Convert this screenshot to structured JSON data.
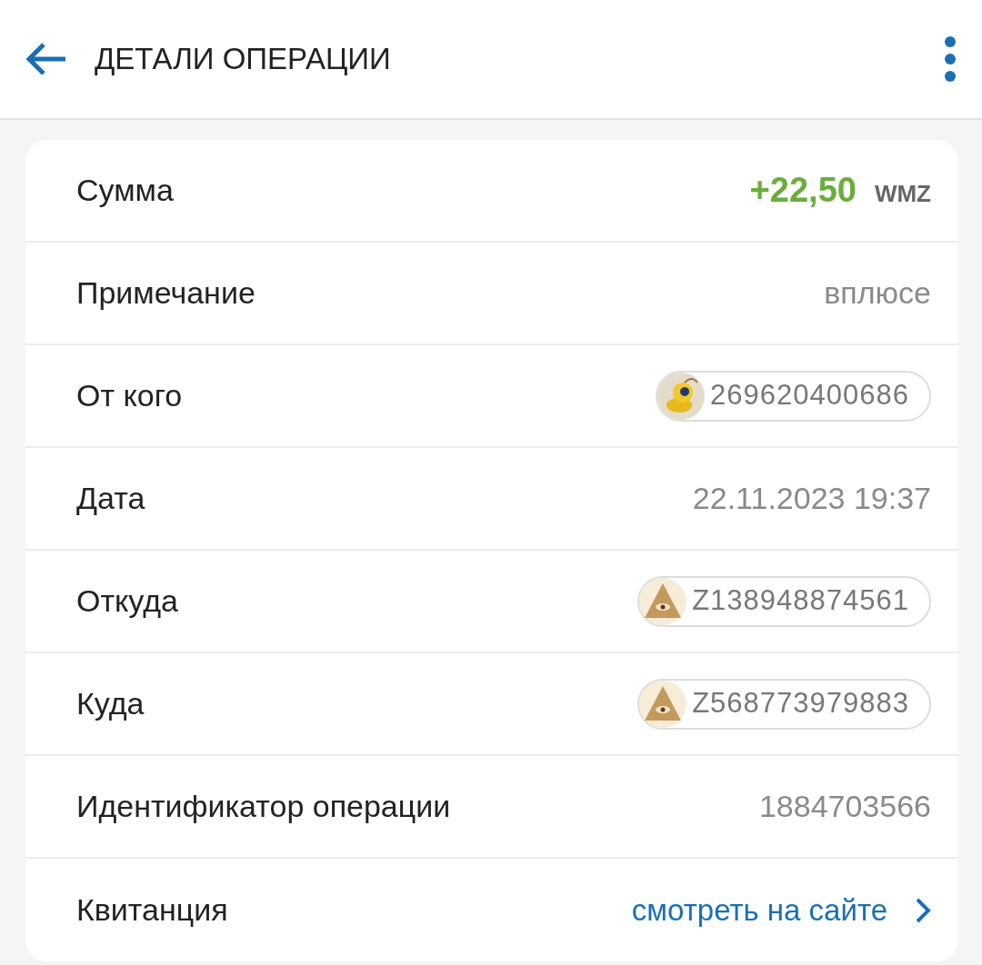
{
  "header": {
    "title": "ДЕТАЛИ ОПЕРАЦИИ"
  },
  "rows": [
    {
      "kind": "amount",
      "label": "Сумма",
      "value": "+22,50",
      "unit": "WMZ"
    },
    {
      "kind": "text",
      "label": "Примечание",
      "value": "вплюсе"
    },
    {
      "kind": "user",
      "label": "От кого",
      "value": "269620400686"
    },
    {
      "kind": "text",
      "label": "Дата",
      "value": "22.11.2023 19:37"
    },
    {
      "kind": "wallet",
      "label": "Откуда",
      "value": "Z138948874561"
    },
    {
      "kind": "wallet",
      "label": "Куда",
      "value": "Z568773979883"
    },
    {
      "kind": "text",
      "label": "Идентификатор операции",
      "value": "1884703566"
    },
    {
      "kind": "link",
      "label": "Квитанция",
      "value": "смотреть на сайте"
    }
  ]
}
